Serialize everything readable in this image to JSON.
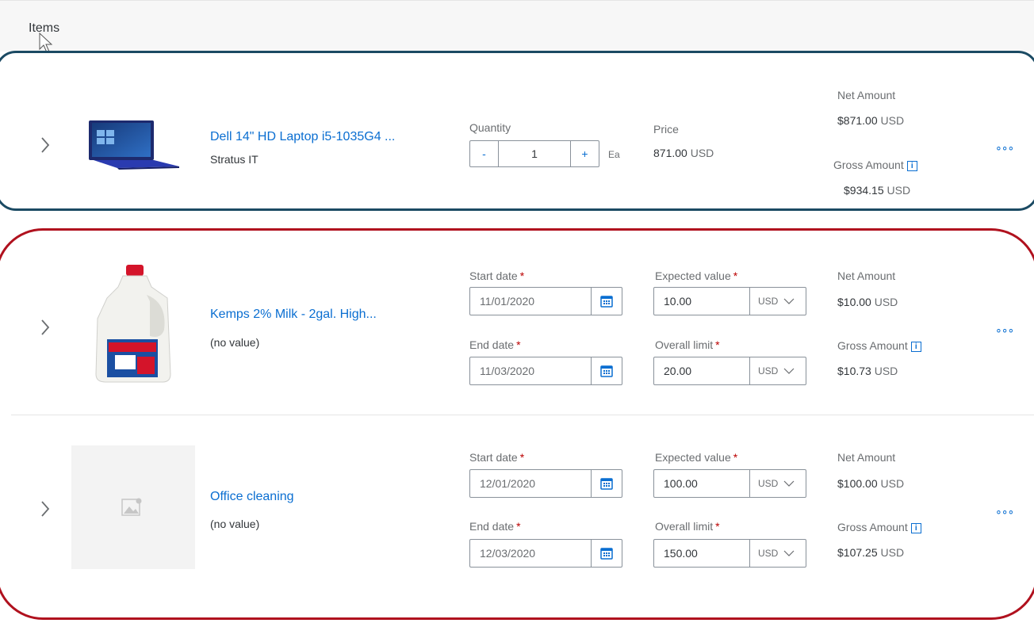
{
  "header": {
    "title": "Items"
  },
  "items": [
    {
      "name": "Dell 14\" HD Laptop i5-1035G4 ...",
      "supplier": "Stratus IT",
      "quantity": {
        "label": "Quantity",
        "minus": "-",
        "value": "1",
        "plus": "+",
        "unit": "Ea"
      },
      "price": {
        "label": "Price",
        "amount": "871.00",
        "currency": "USD"
      },
      "net": {
        "label": "Net Amount",
        "amount": "$871.00",
        "currency": "USD"
      },
      "gross": {
        "label": "Gross Amount",
        "amount": "$934.15",
        "currency": "USD"
      },
      "more": "∘∘∘"
    },
    {
      "name": "Kemps 2% Milk - 2gal. High...",
      "supplier": "(no value)",
      "start_date": {
        "label": "Start date",
        "value": "11/01/2020"
      },
      "end_date": {
        "label": "End date",
        "value": "11/03/2020"
      },
      "expected_value": {
        "label": "Expected value",
        "amount": "10.00",
        "currency": "USD"
      },
      "overall_limit": {
        "label": "Overall limit",
        "amount": "20.00",
        "currency": "USD"
      },
      "net": {
        "label": "Net Amount",
        "amount": "$10.00",
        "currency": "USD"
      },
      "gross": {
        "label": "Gross Amount",
        "amount": "$10.73",
        "currency": "USD"
      },
      "more": "∘∘∘"
    },
    {
      "name": "Office cleaning",
      "supplier": "(no value)",
      "start_date": {
        "label": "Start date",
        "value": "12/01/2020"
      },
      "end_date": {
        "label": "End date",
        "value": "12/03/2020"
      },
      "expected_value": {
        "label": "Expected value",
        "amount": "100.00",
        "currency": "USD"
      },
      "overall_limit": {
        "label": "Overall limit",
        "amount": "150.00",
        "currency": "USD"
      },
      "net": {
        "label": "Net Amount",
        "amount": "$100.00",
        "currency": "USD"
      },
      "gross": {
        "label": "Gross Amount",
        "amount": "$107.25",
        "currency": "USD"
      },
      "more": "∘∘∘"
    }
  ],
  "required_marker": "*",
  "info_glyph": "i",
  "colors": {
    "link": "#0a6ed1",
    "highlight_blue": "#1b4a63",
    "highlight_red": "#b0111e",
    "required": "#bb0000"
  }
}
